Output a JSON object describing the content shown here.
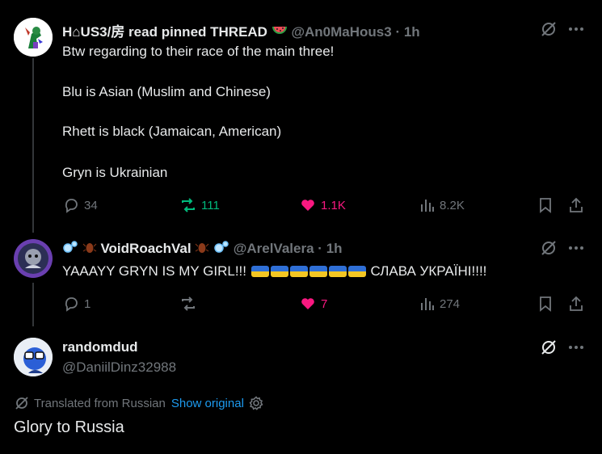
{
  "tweets": [
    {
      "author_name": "H⌂US3/房 read pinned THREAD",
      "handle": "@An0MaHous3",
      "time": "1h",
      "lines": [
        "Btw regarding to their race of the main three!",
        "Blu is Asian (Muslim and Chinese)",
        "Rhett is black (Jamaican, American)",
        "Gryn is Ukrainian"
      ],
      "replies": "34",
      "reposts": "111",
      "likes": "1.1K",
      "views": "8.2K"
    },
    {
      "author_name": "VoidRoachVal",
      "handle": "@ArelValera",
      "time": "1h",
      "text_prefix": "YAAAYY GRYN IS MY GIRL!!!",
      "text_suffix": "СЛАВА УКРАЇНІ!!!!",
      "replies": "1",
      "reposts": "",
      "likes": "7",
      "views": "274"
    }
  ],
  "main_tweet": {
    "author_name": "randomdud",
    "handle": "@DaniilDinz32988",
    "translated_label": "Translated from Russian",
    "show_original": "Show original",
    "text": "Glory to Russia"
  },
  "colors": {
    "background": "#000000",
    "muted": "#71767b",
    "repost_active": "#00ba7c",
    "like_active": "#f91880",
    "link": "#1d9bf0"
  }
}
